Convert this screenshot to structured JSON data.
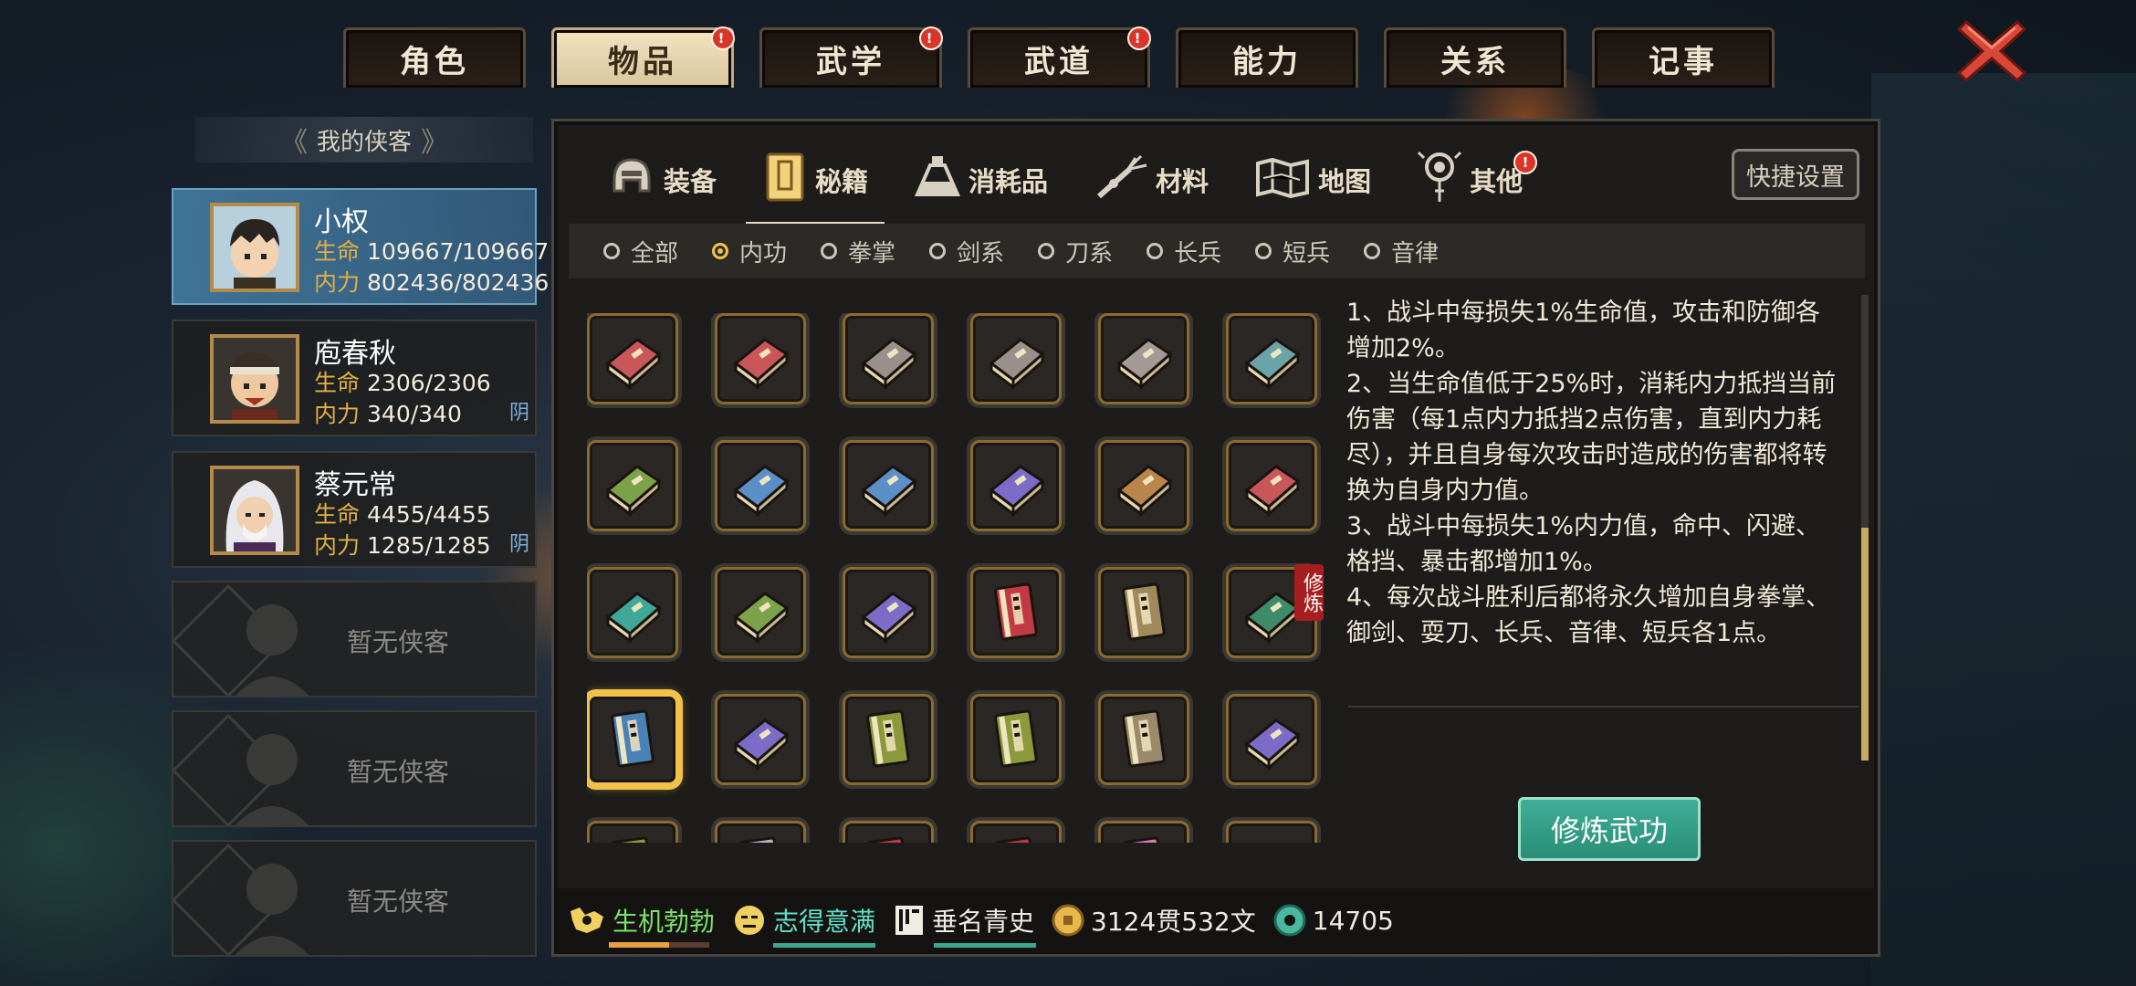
{
  "top_tabs": [
    {
      "label": "角色",
      "active": false,
      "badge": false
    },
    {
      "label": "物品",
      "active": true,
      "badge": true
    },
    {
      "label": "武学",
      "active": false,
      "badge": true
    },
    {
      "label": "武道",
      "active": false,
      "badge": true
    },
    {
      "label": "能力",
      "active": false,
      "badge": false
    },
    {
      "label": "关系",
      "active": false,
      "badge": false
    },
    {
      "label": "记事",
      "active": false,
      "badge": false
    }
  ],
  "badge_mark": "!",
  "roster": {
    "title": "我的侠客",
    "characters": [
      {
        "name": "小权",
        "hp_label": "生命",
        "hp": "109667/109667",
        "mp_label": "内力",
        "mp": "802436/802436",
        "tag": ""
      },
      {
        "name": "庖春秋",
        "hp_label": "生命",
        "hp": "2306/2306",
        "mp_label": "内力",
        "mp": "340/340",
        "tag": "阴"
      },
      {
        "name": "蔡元常",
        "hp_label": "生命",
        "hp": "4455/4455",
        "mp_label": "内力",
        "mp": "1285/1285",
        "tag": "阴"
      }
    ],
    "empty_label": "暂无侠客"
  },
  "category_tabs": [
    {
      "label": "装备",
      "icon": "helmet-icon",
      "badge": false
    },
    {
      "label": "秘籍",
      "icon": "book-icon",
      "badge": false
    },
    {
      "label": "消耗品",
      "icon": "potion-icon",
      "badge": false
    },
    {
      "label": "材料",
      "icon": "herb-icon",
      "badge": false
    },
    {
      "label": "地图",
      "icon": "map-icon",
      "badge": false
    },
    {
      "label": "其他",
      "icon": "pendant-icon",
      "badge": true
    }
  ],
  "quick_settings": "快捷设置",
  "filters": [
    "全部",
    "内功",
    "拳掌",
    "剑系",
    "刀系",
    "长兵",
    "短兵",
    "音律"
  ],
  "selected_filter": "内功",
  "train_tag": "修炼",
  "books": [
    [
      "#c9575a",
      "#c9575a",
      "#9a8f8a",
      "#9a8f8a",
      "#a39a95",
      "#6aa4a8"
    ],
    [
      "#7ca24a",
      "#5c8ec8",
      "#5c8ec8",
      "#7c6cc8",
      "#b8864a",
      "#c9575a"
    ],
    [
      "#3fa898",
      "#7ca24a",
      "#7c6cc8",
      "#c23a44",
      "#a08a5c",
      "#3f8a68"
    ],
    [
      "#4a82b8",
      "#7c6cc8",
      "#8a9a3a",
      "#8a9a3a",
      "#9a8a6a",
      "#7c6cc8"
    ],
    [
      "#8a9a3a",
      "#a8b4c8",
      "#c23a44",
      "#c23a44",
      "#d87ab8",
      "#4ac868"
    ]
  ],
  "description": [
    "1、战斗中每损失1%生命值，攻击和防御各增加2%。",
    "2、当生命值低于25%时，消耗内力抵挡当前伤害（每1点内力抵挡2点伤害，直到内力耗尽），并且自身每次攻击时造成的伤害都将转换为自身内力值。",
    "3、战斗中每损失1%内力值，命中、闪避、格挡、暴击都增加1%。",
    "4、每次战斗胜利后都将永久增加自身拳掌、御剑、耍刀、长兵、音律、短兵各1点。"
  ],
  "train_button": "修炼武功",
  "status": {
    "health": "生机勃勃",
    "mood": "志得意满",
    "fame": "垂名青史",
    "money": "3124贯532文",
    "jade": "14705"
  },
  "colors": {
    "accent_gold": "#f2c14a",
    "teal_button": "#3fae96",
    "badge_red": "#d9362b"
  }
}
